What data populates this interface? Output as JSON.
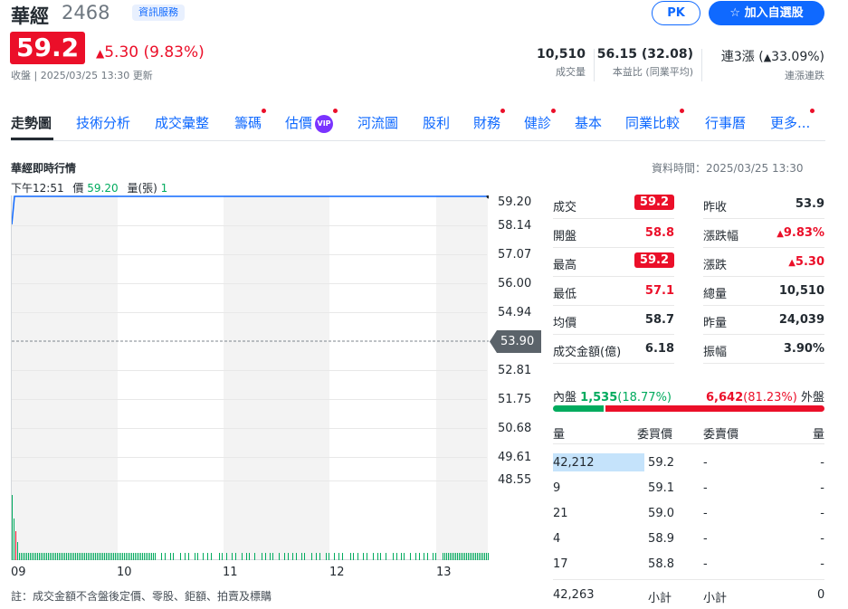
{
  "header": {
    "name": "華經",
    "code": "2468",
    "tag": "資訊服務",
    "pk_label": "PK",
    "add_label": "加入自選股",
    "price": "59.2",
    "change": "5.30 (9.83%)",
    "sub": "收盤 | 2025/03/25 13:30 更新"
  },
  "kpis": [
    {
      "value": "10,510",
      "label": "成交量"
    },
    {
      "value": "56.15 (32.08)",
      "label": "本益比 (同業平均)"
    },
    {
      "value_prefix": "連3漲 (",
      "value_pct": "33.09%)",
      "label": "連漲連跌"
    }
  ],
  "tabs": [
    "走勢圖",
    "技術分析",
    "成交彙整",
    "籌碼",
    "估價",
    "河流圖",
    "股利",
    "財務",
    "健診",
    "基本",
    "同業比較",
    "行事曆",
    "更多..."
  ],
  "vip_label": "VIP",
  "section": {
    "title": "華經即時行情",
    "time": "資料時間：2025/03/25 13:30",
    "info_time": "下午12:51",
    "info_price_label": "價",
    "info_price": "59.20",
    "info_vol_label": "量(張)",
    "info_vol": "1"
  },
  "chart_data": {
    "type": "line",
    "y_ticks": [
      "59.20",
      "58.14",
      "57.07",
      "56.00",
      "54.94",
      "53.90",
      "52.81",
      "51.75",
      "50.68",
      "49.61",
      "48.55"
    ],
    "ylim": [
      48.55,
      59.2
    ],
    "reference": "53.90",
    "x_ticks": [
      "09",
      "10",
      "11",
      "12",
      "13"
    ],
    "points": [
      {
        "t": "09:00",
        "price": 58.1
      },
      {
        "t": "09:01",
        "price": 59.2
      },
      {
        "t": "13:30",
        "price": 59.2
      }
    ],
    "volume_note": "volume bars along bottom"
  },
  "note": "註：成交金額不含盤後定價、零股、鉅額、拍賣及標購",
  "quote_rows": [
    {
      "l1": "成交",
      "v1": "59.2",
      "l2": "昨收",
      "v2": "53.9"
    },
    {
      "l1": "開盤",
      "v1": "58.8",
      "l2": "漲跌幅",
      "v2": "9.83%"
    },
    {
      "l1": "最高",
      "v1": "59.2",
      "l2": "漲跌",
      "v2": "5.30"
    },
    {
      "l1": "最低",
      "v1": "57.1",
      "l2": "總量",
      "v2": "10,510"
    },
    {
      "l1": "均價",
      "v1": "58.7",
      "l2": "昨量",
      "v2": "24,039"
    },
    {
      "l1": "成交金額(億)",
      "v1": "6.18",
      "l2": "振幅",
      "v2": "3.90%"
    }
  ],
  "inout": {
    "in_label": "內盤",
    "in_value": "1,535",
    "in_pct": "(18.77%)",
    "out_value": "6,642",
    "out_pct": "(81.23%)",
    "out_label": "外盤",
    "in_fraction": 0.1877,
    "colors": {
      "in": "#00ab5e",
      "out": "#eb0f29"
    }
  },
  "orderbook": {
    "headers": [
      "量",
      "委買價",
      "委賣價",
      "量"
    ],
    "rows": [
      {
        "bv": "42,212",
        "bp": "59.2",
        "sp": "-",
        "sv": "-"
      },
      {
        "bv": "9",
        "bp": "59.1",
        "sp": "-",
        "sv": "-"
      },
      {
        "bv": "21",
        "bp": "59.0",
        "sp": "-",
        "sv": "-"
      },
      {
        "bv": "4",
        "bp": "58.9",
        "sp": "-",
        "sv": "-"
      },
      {
        "bv": "17",
        "bp": "58.8",
        "sp": "-",
        "sv": "-"
      }
    ],
    "footer": {
      "bv": "42,263",
      "bl": "小計",
      "sl": "小計",
      "sv": "0"
    }
  }
}
